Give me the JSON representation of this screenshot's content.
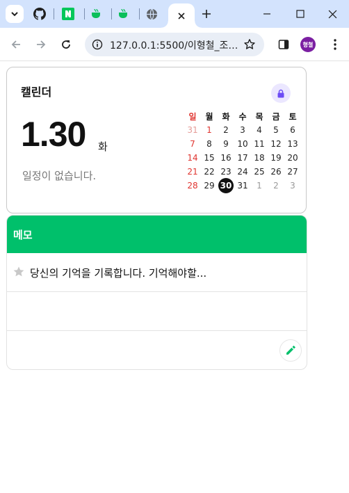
{
  "browser": {
    "tabs": [
      {
        "icon": "github-icon"
      },
      {
        "icon": "naver-icon"
      },
      {
        "icon": "cup-icon"
      },
      {
        "icon": "cup-icon"
      },
      {
        "icon": "globe-icon"
      },
      {
        "icon": "close-icon",
        "active": true
      }
    ],
    "new_tab_label": "+",
    "url": "127.0.0.1:5500/이형철_조별...",
    "profile_initials": "형철"
  },
  "calendar": {
    "title": "캘린더",
    "selected_date": "1.30",
    "selected_day": "화",
    "no_events_text": "일정이 없습니다.",
    "weekdays": [
      "일",
      "월",
      "화",
      "수",
      "목",
      "금",
      "토"
    ],
    "weeks": [
      [
        "31",
        "1",
        "2",
        "3",
        "4",
        "5",
        "6"
      ],
      [
        "7",
        "8",
        "9",
        "10",
        "11",
        "12",
        "13"
      ],
      [
        "14",
        "15",
        "16",
        "17",
        "18",
        "19",
        "20"
      ],
      [
        "21",
        "22",
        "23",
        "24",
        "25",
        "26",
        "27"
      ],
      [
        "28",
        "29",
        "30",
        "31",
        "1",
        "2",
        "3"
      ]
    ],
    "today": "30",
    "colors": {
      "sunday": "#e0342f",
      "lock_accent": "#6c4cf5"
    }
  },
  "memo": {
    "title": "메모",
    "items": [
      {
        "text": "당신의 기억을 기록합니다. 기억해야할...",
        "starred": false
      }
    ],
    "colors": {
      "header": "#00c06b"
    }
  }
}
